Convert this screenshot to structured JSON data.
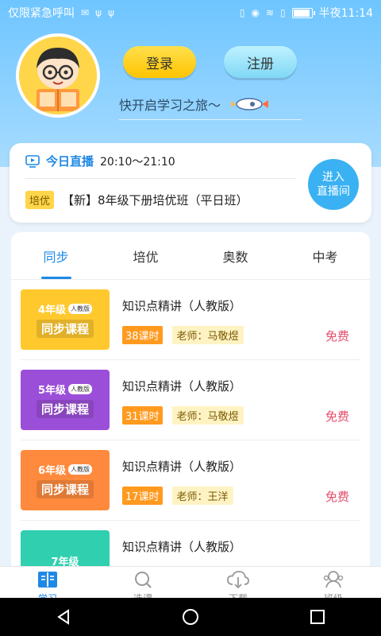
{
  "status_bar": {
    "carrier": "仅限紧急呼叫",
    "time": "半夜11:14"
  },
  "header": {
    "login_label": "登录",
    "register_label": "注册",
    "slogan": "快开启学习之旅～"
  },
  "live": {
    "title": "今日直播",
    "time": "20:10～21:10",
    "tag": "培优",
    "course": "【新】8年级下册培优班（平日班）",
    "enter_line1": "进入",
    "enter_line2": "直播间"
  },
  "tabs": [
    {
      "label": "同步",
      "active": true
    },
    {
      "label": "培优"
    },
    {
      "label": "奥数"
    },
    {
      "label": "中考"
    }
  ],
  "courses": [
    {
      "thumb_grade": "4年级",
      "thumb_edition": "人教版",
      "thumb_name": "同步课程",
      "thumb_color": "#ffc92e",
      "title": "知识点精讲（人教版）",
      "hours": "38课时",
      "teacher": "老师：马敬煜",
      "price": "免费"
    },
    {
      "thumb_grade": "5年级",
      "thumb_edition": "人教版",
      "thumb_name": "同步课程",
      "thumb_color": "#9b4fd8",
      "title": "知识点精讲（人教版）",
      "hours": "31课时",
      "teacher": "老师：马敬煜",
      "price": "免费"
    },
    {
      "thumb_grade": "6年级",
      "thumb_edition": "人教版",
      "thumb_name": "同步课程",
      "thumb_color": "#ff8a3d",
      "title": "知识点精讲（人教版）",
      "hours": "17课时",
      "teacher": "老师：王洋",
      "price": "免费"
    },
    {
      "thumb_grade": "7年级",
      "thumb_edition": "",
      "thumb_name": "",
      "thumb_color": "#2fcfb0",
      "title": "知识点精讲（人教版）",
      "hours": "",
      "teacher": "",
      "price": ""
    }
  ],
  "bottom_nav": [
    {
      "label": "学习",
      "icon": "book-icon",
      "active": true
    },
    {
      "label": "选课",
      "icon": "search-icon"
    },
    {
      "label": "下载",
      "icon": "cloud-download-icon"
    },
    {
      "label": "班级",
      "icon": "class-icon"
    }
  ],
  "colors": {
    "accent": "#1e88e5",
    "price": "#e54d6b",
    "hours": "#ff9a1f"
  }
}
